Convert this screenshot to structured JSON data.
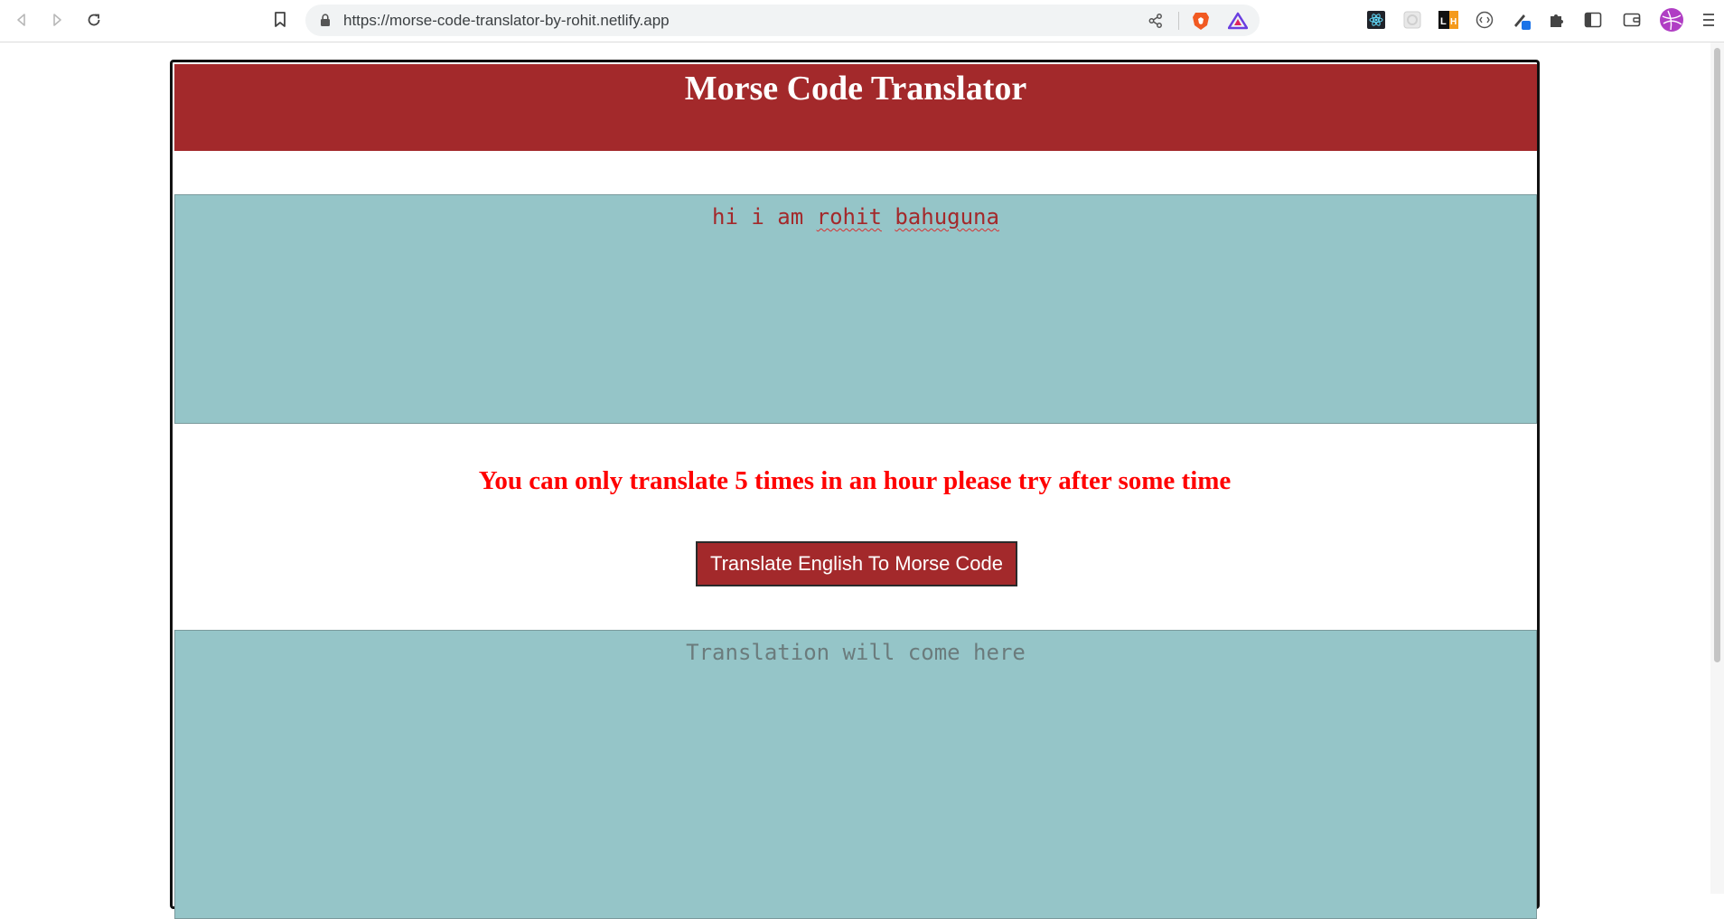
{
  "browser": {
    "url": "https://morse-code-translator-by-rohit.netlify.app",
    "nav_icons": [
      "back-icon",
      "forward-icon",
      "reload-icon",
      "bookmark-icon"
    ],
    "extension_icons": [
      "react-devtools-icon",
      "extension-icon",
      "lighthouse-icon",
      "devtools-extension-icon",
      "color-picker-icon",
      "puzzle-icon",
      "sidebar-icon",
      "wallet-icon",
      "profile-avatar",
      "menu-icon"
    ]
  },
  "app": {
    "title": "Morse Code Translator",
    "input_text": {
      "plain": "hi i am ",
      "word1": "rohit",
      "space": " ",
      "word2": "bahuguna"
    },
    "error_message": "You can only translate 5 times in an hour please try after some time",
    "translate_button_label": "Translate English To Morse Code",
    "output_placeholder": "Translation will come here"
  },
  "colors": {
    "header_bg": "#a3292b",
    "textarea_bg": "#95c5c8",
    "error_text": "#ff0000",
    "button_bg": "#a3292b"
  }
}
